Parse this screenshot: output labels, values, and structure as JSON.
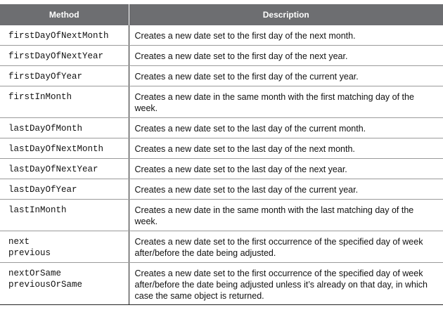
{
  "table": {
    "headers": {
      "method": "Method",
      "description": "Description"
    },
    "rows": [
      {
        "methods": [
          "firstDayOfNextMonth"
        ],
        "description": "Creates a new date set to the first day of the next month."
      },
      {
        "methods": [
          "firstDayOfNextYear"
        ],
        "description": "Creates a new date set to the first day of the next year."
      },
      {
        "methods": [
          "firstDayOfYear"
        ],
        "description": "Creates a new date set to the first day of the current year."
      },
      {
        "methods": [
          "firstInMonth"
        ],
        "description": "Creates a new date in the same month with the first matching day of the week."
      },
      {
        "methods": [
          "lastDayOfMonth"
        ],
        "description": "Creates a new date set to the last day of the current month."
      },
      {
        "methods": [
          "lastDayOfNextMonth"
        ],
        "description": "Creates a new date set to the last day of the next month."
      },
      {
        "methods": [
          "lastDayOfNextYear"
        ],
        "description": "Creates a new date set to the last day of the next year."
      },
      {
        "methods": [
          "lastDayOfYear"
        ],
        "description": "Creates a new date set to the last day of the current year."
      },
      {
        "methods": [
          "lastInMonth"
        ],
        "description": "Creates a new date in the same month with the last matching day of the week."
      },
      {
        "methods": [
          "next",
          "previous"
        ],
        "description": "Creates a new date set to the first occurrence of the specified day of week after/before the date being adjusted."
      },
      {
        "methods": [
          "nextOrSame",
          "previousOrSame"
        ],
        "description": "Creates a new date set to the first occurrence of the specified day of week after/before the date being adjusted unless it’s already on that day, in which case the same object is returned."
      }
    ]
  }
}
